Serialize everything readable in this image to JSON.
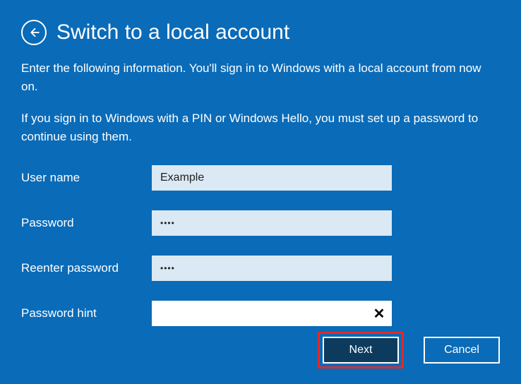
{
  "header": {
    "title": "Switch to a local account"
  },
  "description": "Enter the following information. You'll sign in to Windows with a local account from now on.",
  "note": "If you sign in to Windows with a PIN or Windows Hello, you must set up a password to continue using them.",
  "form": {
    "username_label": "User name",
    "username_value": "Example",
    "password_label": "Password",
    "password_value": "••••",
    "reenter_label": "Reenter password",
    "reenter_value": "••••",
    "hint_label": "Password hint",
    "hint_value": ""
  },
  "buttons": {
    "next": "Next",
    "cancel": "Cancel"
  }
}
